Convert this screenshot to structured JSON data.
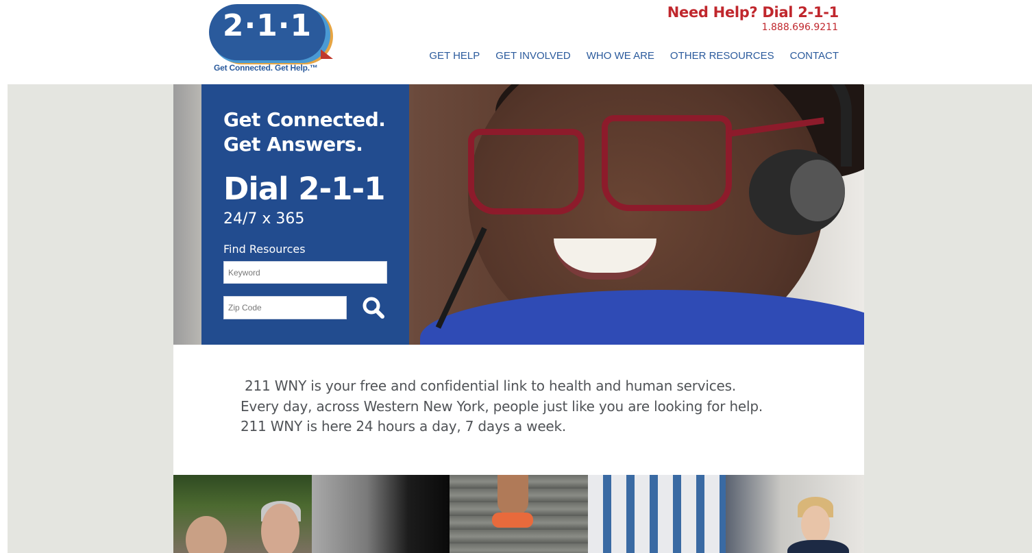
{
  "header": {
    "logo_text": "2·1·1",
    "logo_tagline": "Get Connected. Get Help.™",
    "help_title": "Need Help? Dial 2-1-1",
    "help_phone": "1.888.696.9211",
    "nav": [
      {
        "label": "GET HELP"
      },
      {
        "label": "GET INVOLVED"
      },
      {
        "label": "WHO WE ARE"
      },
      {
        "label": "OTHER RESOURCES"
      },
      {
        "label": "CONTACT"
      }
    ]
  },
  "hero": {
    "title_line1": "Get Connected.",
    "title_line2": "Get Answers.",
    "dial": "Dial 2-1-1",
    "availability": "24/7 x 365",
    "find_label": "Find Resources",
    "keyword_placeholder": "Keyword",
    "zip_placeholder": "Zip Code"
  },
  "intro": {
    "line1": "211 WNY is your free and confidential link to health and human services.",
    "line2": "Every day, across Western New York, people just like you are looking for help.",
    "line3": "211 WNY is here 24 hours a day, 7 days a week."
  },
  "colors": {
    "brand_blue": "#224c8f",
    "brand_red": "#c0272d",
    "nav_blue": "#2a5a9c",
    "page_bg": "#e4e5e0"
  },
  "icons": {
    "search": "search-icon"
  }
}
